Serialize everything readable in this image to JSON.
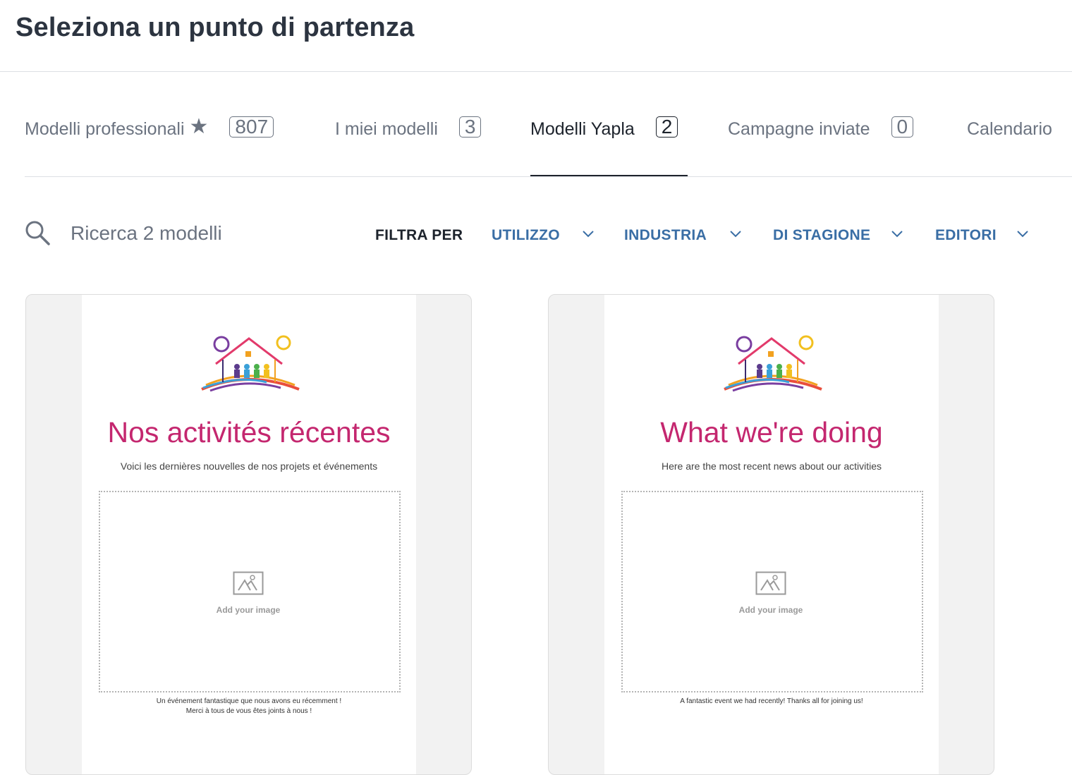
{
  "page": {
    "title": "Seleziona un punto di partenza"
  },
  "tabs": [
    {
      "label": "Modelli professionali",
      "count": "807",
      "starred": true,
      "active": false
    },
    {
      "label": "I miei modelli",
      "count": "3",
      "active": false
    },
    {
      "label": "Modelli Yapla",
      "count": "2",
      "active": true
    },
    {
      "label": "Campagne inviate",
      "count": "0",
      "active": false
    },
    {
      "label": "Calendario",
      "active": false
    }
  ],
  "search": {
    "placeholder": "Ricerca 2 modelli",
    "value": ""
  },
  "filters": {
    "label": "FILTRA PER",
    "items": [
      "UTILIZZO",
      "INDUSTRIA",
      "DI STAGIONE",
      "EDITORI"
    ]
  },
  "templates": [
    {
      "title": "Nos activités récentes",
      "subtitle": "Voici les dernières nouvelles de nos projets et événements",
      "image_placeholder": "Add your image",
      "caption_lines": [
        "Un événement fantastique que nous avons eu récemment !",
        "Merci à tous de vous êtes joints à nous !"
      ]
    },
    {
      "title": "What we're doing",
      "subtitle": "Here are the most recent news about our activities",
      "image_placeholder": "Add your image",
      "caption_lines": [
        "A fantastic event we had recently! Thanks all for joining us!"
      ]
    }
  ],
  "colors": {
    "link": "#3a6ea5",
    "accent_title": "#c4276f",
    "text_dark": "#1d232c",
    "text_muted": "#6b7380"
  }
}
